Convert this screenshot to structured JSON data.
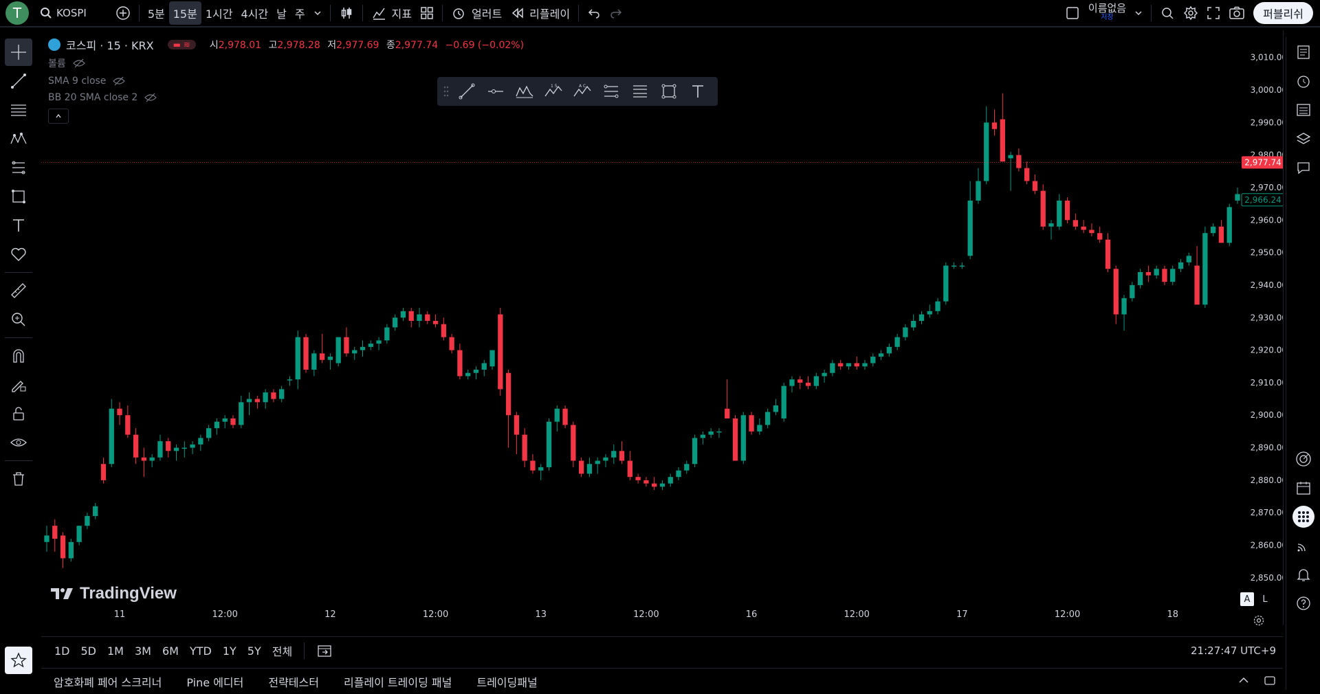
{
  "topbar": {
    "avatar_letter": "T",
    "symbol_search": "KOSPI",
    "intervals": [
      "5분",
      "15분",
      "1시간",
      "4시간",
      "날",
      "주"
    ],
    "selected_interval": "15분",
    "indicators_label": "지표",
    "alert_label": "얼러트",
    "replay_label": "리플레이",
    "layout_name": "이름없음",
    "layout_sub": "저장",
    "publish_label": "퍼블리쉬"
  },
  "legend": {
    "title": "코스피 · 15 · KRX",
    "o_label": "시",
    "o": "2,978.01",
    "h_label": "고",
    "h": "2,978.28",
    "l_label": "저",
    "l": "2,977.69",
    "c_label": "종",
    "c": "2,977.74",
    "change": "−0.69 (−0.02%)",
    "indicators": [
      "볼륨",
      "SMA 9 close",
      "BB 20 SMA close 2"
    ]
  },
  "watermark": "TradingView",
  "autoscale": {
    "a": "A",
    "l": "L"
  },
  "bottombar": {
    "ranges": [
      "1D",
      "5D",
      "1M",
      "3M",
      "6M",
      "YTD",
      "1Y",
      "5Y",
      "전체"
    ],
    "clock": "21:27:47 UTC+9"
  },
  "tabs": [
    "암호화폐 페어 스크리너",
    "Pine 에디터",
    "전략테스터",
    "리플레이 트레이딩 패널",
    "트레이딩패널"
  ],
  "colors": {
    "up": "#089981",
    "down": "#f23645",
    "bg": "#000000",
    "text": "#d1d4dc",
    "grid": "#1e222d"
  },
  "chart_data": {
    "type": "candlestick",
    "title": "코스피 · 15 · KRX",
    "ylim": [
      2843,
      3015
    ],
    "y_ticks": [
      2850,
      2860,
      2870,
      2880,
      2890,
      2900,
      2910,
      2920,
      2930,
      2940,
      2950,
      2960,
      2970,
      2980,
      2990,
      3000,
      3010
    ],
    "y_tick_labels": [
      "2,850.00",
      "2,860.00",
      "2,870.00",
      "2,880.00",
      "2,890.00",
      "2,900.00",
      "2,910.00",
      "2,920.00",
      "2,930.00",
      "2,940.00",
      "2,950.00",
      "2,960.00",
      "2,970.00",
      "2,980.00",
      "2,990.00",
      "3,000.00",
      "3,010.00"
    ],
    "x_tick_labels": [
      {
        "i": 9,
        "label": "11"
      },
      {
        "i": 22,
        "label": "12:00"
      },
      {
        "i": 35,
        "label": "12"
      },
      {
        "i": 48,
        "label": "12:00"
      },
      {
        "i": 61,
        "label": "13"
      },
      {
        "i": 74,
        "label": "12:00"
      },
      {
        "i": 87,
        "label": "16"
      },
      {
        "i": 100,
        "label": "12:00"
      },
      {
        "i": 113,
        "label": "17"
      },
      {
        "i": 126,
        "label": "12:00"
      },
      {
        "i": 139,
        "label": "18"
      }
    ],
    "last_price_label": "2,977.74",
    "last_price": 2977.74,
    "secondary_price_label": "2,966.24",
    "secondary_price": 2966.24,
    "candles": [
      [
        2861,
        2866,
        2858,
        2863
      ],
      [
        2866,
        2868,
        2858,
        2862
      ],
      [
        2863,
        2864,
        2853,
        2856
      ],
      [
        2856,
        2862,
        2855,
        2861
      ],
      [
        2861,
        2866,
        2860,
        2866
      ],
      [
        2866,
        2870,
        2865,
        2869
      ],
      [
        2869,
        2873,
        2868,
        2872
      ],
      [
        2885,
        2887,
        2879,
        2880
      ],
      [
        2885,
        2905,
        2884,
        2902
      ],
      [
        2902,
        2904,
        2897,
        2900
      ],
      [
        2900,
        2903,
        2893,
        2894
      ],
      [
        2894,
        2896,
        2885,
        2887
      ],
      [
        2887,
        2890,
        2881,
        2886
      ],
      [
        2886,
        2888,
        2884,
        2887
      ],
      [
        2887,
        2894,
        2886,
        2892
      ],
      [
        2892,
        2893,
        2887,
        2889
      ],
      [
        2889,
        2891,
        2886,
        2890
      ],
      [
        2890,
        2892,
        2887,
        2890
      ],
      [
        2890,
        2892,
        2888,
        2891
      ],
      [
        2891,
        2894,
        2889,
        2893
      ],
      [
        2893,
        2897,
        2892,
        2896
      ],
      [
        2896,
        2899,
        2894,
        2898
      ],
      [
        2898,
        2900,
        2896,
        2899
      ],
      [
        2899,
        2900,
        2896,
        2897
      ],
      [
        2897,
        2906,
        2896,
        2904
      ],
      [
        2904,
        2907,
        2900,
        2905
      ],
      [
        2905,
        2906,
        2902,
        2904
      ],
      [
        2904,
        2908,
        2902,
        2907
      ],
      [
        2907,
        2908,
        2904,
        2905
      ],
      [
        2905,
        2909,
        2904,
        2908
      ],
      [
        2911,
        2912,
        2909,
        2911
      ],
      [
        2911,
        2926,
        2908,
        2924
      ],
      [
        2924,
        2925,
        2913,
        2914
      ],
      [
        2914,
        2920,
        2912,
        2919
      ],
      [
        2919,
        2925,
        2916,
        2917
      ],
      [
        2917,
        2919,
        2914,
        2918
      ],
      [
        2916,
        2924,
        2915,
        2924
      ],
      [
        2924,
        2927,
        2918,
        2919
      ],
      [
        2919,
        2921,
        2917,
        2920
      ],
      [
        2920,
        2923,
        2918,
        2921
      ],
      [
        2921,
        2923,
        2920,
        2922
      ],
      [
        2922,
        2924,
        2920,
        2923
      ],
      [
        2923,
        2928,
        2922,
        2927
      ],
      [
        2927,
        2931,
        2926,
        2930
      ],
      [
        2930,
        2933,
        2929,
        2932
      ],
      [
        2932,
        2933,
        2927,
        2929
      ],
      [
        2929,
        2933,
        2927,
        2931
      ],
      [
        2931,
        2932,
        2928,
        2929
      ],
      [
        2929,
        2931,
        2927,
        2928
      ],
      [
        2928,
        2930,
        2923,
        2924
      ],
      [
        2924,
        2925,
        2919,
        2920
      ],
      [
        2920,
        2922,
        2911,
        2912
      ],
      [
        2912,
        2914,
        2911,
        2913
      ],
      [
        2913,
        2915,
        2911,
        2914
      ],
      [
        2914,
        2917,
        2912,
        2916
      ],
      [
        2915,
        2920,
        2914,
        2920
      ],
      [
        2931,
        2933,
        2906,
        2908
      ],
      [
        2913,
        2914,
        2890,
        2900
      ],
      [
        2900,
        2901,
        2888,
        2894
      ],
      [
        2894,
        2896,
        2884,
        2886
      ],
      [
        2886,
        2888,
        2882,
        2883
      ],
      [
        2883,
        2885,
        2880,
        2884
      ],
      [
        2884,
        2899,
        2883,
        2898
      ],
      [
        2898,
        2903,
        2895,
        2902
      ],
      [
        2902,
        2903,
        2896,
        2897
      ],
      [
        2897,
        2898,
        2884,
        2886
      ],
      [
        2886,
        2887,
        2881,
        2882
      ],
      [
        2882,
        2887,
        2881,
        2885
      ],
      [
        2885,
        2887,
        2882,
        2886
      ],
      [
        2886,
        2888,
        2884,
        2887
      ],
      [
        2887,
        2891,
        2885,
        2889
      ],
      [
        2889,
        2892,
        2885,
        2886
      ],
      [
        2886,
        2889,
        2880,
        2881
      ],
      [
        2881,
        2882,
        2879,
        2880
      ],
      [
        2880,
        2881,
        2878,
        2879
      ],
      [
        2879,
        2881,
        2877,
        2878
      ],
      [
        2878,
        2880,
        2877,
        2879
      ],
      [
        2879,
        2882,
        2878,
        2881
      ],
      [
        2881,
        2884,
        2880,
        2883
      ],
      [
        2883,
        2886,
        2882,
        2885
      ],
      [
        2885,
        2894,
        2884,
        2893
      ],
      [
        2893,
        2895,
        2891,
        2894
      ],
      [
        2894,
        2896,
        2893,
        2895
      ],
      [
        2895,
        2896,
        2893,
        2895
      ],
      [
        2902,
        2911,
        2899,
        2899
      ],
      [
        2899,
        2900,
        2886,
        2886
      ],
      [
        2886,
        2901,
        2885,
        2900
      ],
      [
        2900,
        2901,
        2894,
        2895
      ],
      [
        2895,
        2899,
        2894,
        2897
      ],
      [
        2897,
        2902,
        2896,
        2901
      ],
      [
        2901,
        2905,
        2900,
        2903
      ],
      [
        2899,
        2910,
        2898,
        2909
      ],
      [
        2909,
        2912,
        2907,
        2911
      ],
      [
        2911,
        2912,
        2908,
        2910
      ],
      [
        2910,
        2912,
        2908,
        2909
      ],
      [
        2909,
        2913,
        2908,
        2912
      ],
      [
        2912,
        2914,
        2910,
        2913
      ],
      [
        2913,
        2917,
        2912,
        2916
      ],
      [
        2916,
        2917,
        2914,
        2915
      ],
      [
        2915,
        2916,
        2914,
        2916
      ],
      [
        2916,
        2918,
        2914,
        2915
      ],
      [
        2915,
        2917,
        2914,
        2916
      ],
      [
        2916,
        2919,
        2915,
        2918
      ],
      [
        2918,
        2920,
        2917,
        2919
      ],
      [
        2919,
        2922,
        2918,
        2921
      ],
      [
        2921,
        2925,
        2920,
        2924
      ],
      [
        2924,
        2928,
        2923,
        2927
      ],
      [
        2927,
        2931,
        2926,
        2929
      ],
      [
        2929,
        2932,
        2928,
        2931
      ],
      [
        2931,
        2934,
        2930,
        2932
      ],
      [
        2932,
        2936,
        2931,
        2935
      ],
      [
        2935,
        2947,
        2934,
        2946
      ],
      [
        2946,
        2947,
        2945,
        2946
      ],
      [
        2946,
        2947,
        2945,
        2946
      ],
      [
        2949,
        2972,
        2948,
        2966
      ],
      [
        2966,
        2976,
        2965,
        2972
      ],
      [
        2972,
        2995,
        2971,
        2990
      ],
      [
        2990,
        2994,
        2986,
        2988
      ],
      [
        2991,
        2999,
        2978,
        2978
      ],
      [
        2979,
        2981,
        2969,
        2980
      ],
      [
        2980,
        2982,
        2975,
        2976
      ],
      [
        2976,
        2978,
        2971,
        2972
      ],
      [
        2972,
        2974,
        2968,
        2969
      ],
      [
        2969,
        2971,
        2957,
        2958
      ],
      [
        2958,
        2960,
        2954,
        2959
      ],
      [
        2958,
        2968,
        2957,
        2966
      ],
      [
        2966,
        2967,
        2959,
        2960
      ],
      [
        2960,
        2962,
        2957,
        2958
      ],
      [
        2958,
        2960,
        2956,
        2957
      ],
      [
        2957,
        2959,
        2955,
        2956
      ],
      [
        2956,
        2958,
        2953,
        2954
      ],
      [
        2954,
        2956,
        2944,
        2945
      ],
      [
        2945,
        2946,
        2928,
        2931
      ],
      [
        2931,
        2937,
        2926,
        2936
      ],
      [
        2936,
        2941,
        2935,
        2940
      ],
      [
        2940,
        2945,
        2939,
        2944
      ],
      [
        2944,
        2946,
        2941,
        2943
      ],
      [
        2943,
        2946,
        2942,
        2945
      ],
      [
        2945,
        2946,
        2940,
        2941
      ],
      [
        2941,
        2946,
        2940,
        2945
      ],
      [
        2945,
        2948,
        2944,
        2947
      ],
      [
        2947,
        2950,
        2946,
        2949
      ],
      [
        2946,
        2952,
        2934,
        2934
      ],
      [
        2934,
        2958,
        2933,
        2956
      ],
      [
        2956,
        2959,
        2955,
        2958
      ],
      [
        2958,
        2960,
        2953,
        2953
      ],
      [
        2953,
        2965,
        2952,
        2964
      ],
      [
        2966,
        2970,
        2965,
        2968
      ]
    ]
  }
}
